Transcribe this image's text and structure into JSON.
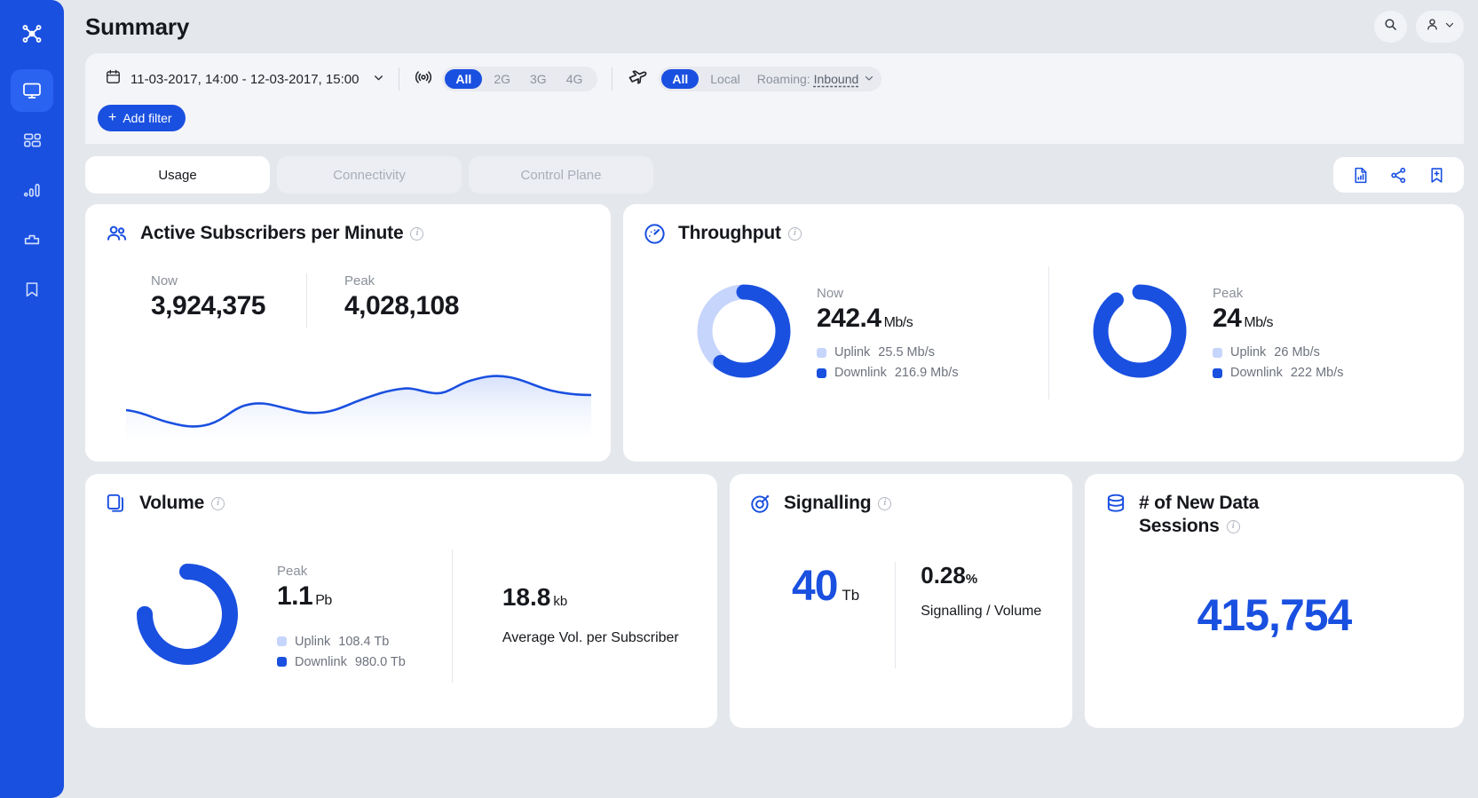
{
  "header": {
    "title": "Summary",
    "search_icon": "search-icon",
    "account_icon": "user-icon",
    "account_chevron": "chevron-down-icon"
  },
  "sidebar": {
    "brand_icon": "network-nodes-icon",
    "items": [
      {
        "icon": "monitor-icon",
        "name": "monitor",
        "active": true
      },
      {
        "icon": "dashboard-grid-icon",
        "name": "dashboard",
        "active": false
      },
      {
        "icon": "bar-chart-icon",
        "name": "analytics",
        "active": false
      },
      {
        "icon": "puzzle-icon",
        "name": "extensions",
        "active": false
      },
      {
        "icon": "bookmark-icon",
        "name": "bookmarks",
        "active": false
      }
    ]
  },
  "filters": {
    "calendar_icon": "calendar-icon",
    "date_range": "11-03-2017, 14:00 - 12-03-2017, 15:00",
    "date_chevron": "chevron-down-icon",
    "network_icon": "signal-broadcast-icon",
    "network_options": [
      "All",
      "2G",
      "3G",
      "4G"
    ],
    "network_selected": "All",
    "roaming_icon": "airplane-icon",
    "roaming_options": [
      "All",
      "Local"
    ],
    "roaming_selected": "All",
    "roaming_label": "Roaming:",
    "roaming_value": "Inbound",
    "roaming_value_chevron": "chevron-down-icon",
    "add_filter_label": "Add filter",
    "add_filter_plus": "plus-icon"
  },
  "tabs": [
    {
      "label": "Usage",
      "active": true
    },
    {
      "label": "Connectivity",
      "active": false
    },
    {
      "label": "Control Plane",
      "active": false
    }
  ],
  "toolbar": {
    "report_icon": "report-document-icon",
    "share_icon": "share-icon",
    "bookmark_add_icon": "bookmark-add-icon"
  },
  "cards": {
    "subscribers": {
      "icon": "people-icon",
      "title": "Active Subscribers per Minute",
      "info_icon": "info-icon",
      "stats": [
        {
          "label": "Now",
          "value": "3,924,375"
        },
        {
          "label": "Peak",
          "value": "4,028,108"
        }
      ]
    },
    "throughput": {
      "icon": "speedometer-icon",
      "title": "Throughput",
      "info_icon": "info-icon",
      "blocks": [
        {
          "label": "Now",
          "value": "242.4",
          "unit": "Mb/s",
          "legend": [
            {
              "name": "Uplink",
              "value": "25.5 Mb/s",
              "color": "#c6d5fb"
            },
            {
              "name": "Downlink",
              "value": "216.9 Mb/s",
              "color": "#1a50e0"
            }
          ]
        },
        {
          "label": "Peak",
          "value": "24",
          "unit": "Mb/s",
          "legend": [
            {
              "name": "Uplink",
              "value": "26 Mb/s",
              "color": "#c6d5fb"
            },
            {
              "name": "Downlink",
              "value": "222 Mb/s",
              "color": "#1a50e0"
            }
          ]
        }
      ]
    },
    "volume": {
      "icon": "layers-icon",
      "title": "Volume",
      "info_icon": "info-icon",
      "peak_label": "Peak",
      "peak_value": "1.1",
      "peak_unit": "Pb",
      "legend": [
        {
          "name": "Uplink",
          "value": "108.4 Tb",
          "color": "#c6d5fb"
        },
        {
          "name": "Downlink",
          "value": "980.0 Tb",
          "color": "#1a50e0"
        }
      ],
      "avg_value": "18.8",
      "avg_unit": "kb",
      "avg_caption": "Average Vol. per Subscriber"
    },
    "signalling": {
      "icon": "target-icon",
      "title": "Signalling",
      "info_icon": "info-icon",
      "value": "40",
      "unit": "Tb",
      "ratio_value": "0.28",
      "ratio_unit": "%",
      "ratio_caption": "Signalling / Volume"
    },
    "sessions": {
      "icon": "database-icon",
      "title": "# of New Data Sessions",
      "info_icon": "info-icon",
      "value": "415,754"
    }
  },
  "chart_data": [
    {
      "type": "area",
      "title": "Active Subscribers per Minute",
      "xlabel": "",
      "ylabel": "",
      "x": [
        0,
        1,
        2,
        3,
        4,
        5,
        6,
        7,
        8,
        9,
        10,
        11,
        12,
        13,
        14,
        15,
        16,
        17,
        18,
        19,
        20,
        21,
        22,
        23,
        24
      ],
      "values": [
        48,
        42,
        33,
        27,
        26,
        30,
        38,
        46,
        50,
        50,
        46,
        41,
        38,
        39,
        44,
        52,
        60,
        68,
        74,
        72,
        76,
        82,
        86,
        84,
        79
      ],
      "ylim": [
        0,
        100
      ],
      "grid": false,
      "series_color": "#1a50e0",
      "fill_color": "#e8eefc"
    },
    {
      "type": "pie",
      "title": "Throughput Now",
      "labels": [
        "Uplink",
        "Downlink"
      ],
      "values": [
        25.5,
        216.9
      ],
      "units": "Mb/s",
      "colors": [
        "#c6d5fb",
        "#1a50e0"
      ],
      "display_total": "242.4",
      "uplink_fraction_drawn": 0.4
    },
    {
      "type": "pie",
      "title": "Throughput Peak",
      "labels": [
        "Uplink",
        "Downlink"
      ],
      "values": [
        26,
        222
      ],
      "units": "Mb/s",
      "colors": [
        "#c6d5fb",
        "#1a50e0"
      ],
      "display_total": "24",
      "uplink_fraction_drawn": 0.105
    },
    {
      "type": "pie",
      "title": "Volume Peak",
      "labels": [
        "Uplink",
        "Downlink"
      ],
      "values": [
        108.4,
        980.0
      ],
      "units": "Tb",
      "colors": [
        "#c6d5fb",
        "#1a50e0"
      ],
      "display_total": "1.1 Pb",
      "uplink_fraction_drawn": 0.25
    }
  ]
}
